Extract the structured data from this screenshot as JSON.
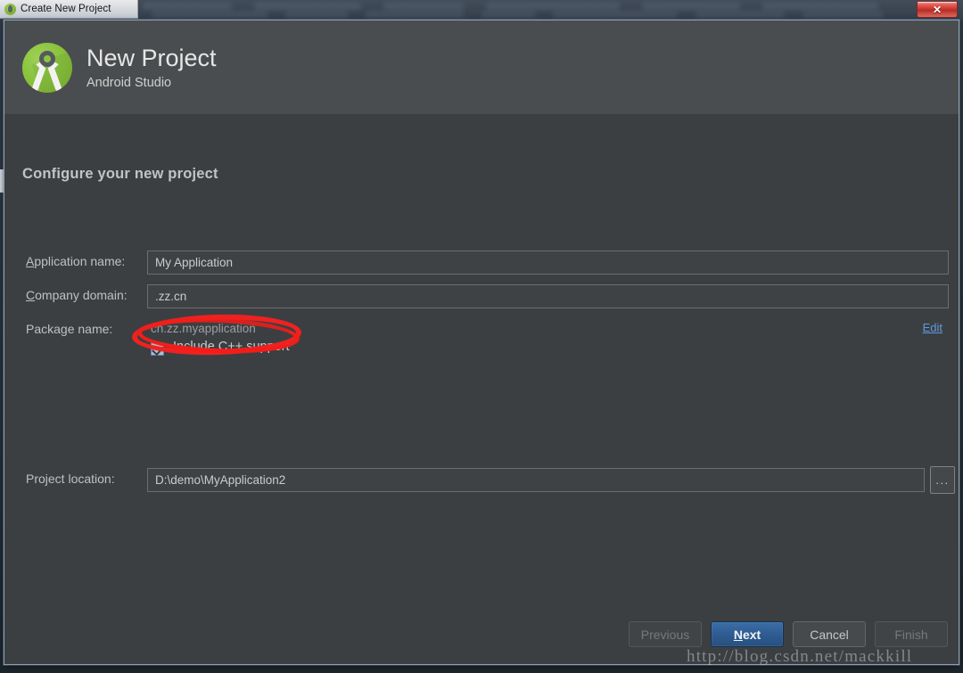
{
  "window": {
    "titlebar_text": "Create New Project",
    "app_icon": "android-studio-icon",
    "close_label": "✕"
  },
  "header": {
    "title": "New Project",
    "subtitle": "Android Studio",
    "logo_icon": "android-studio-logo"
  },
  "step": {
    "title": "Configure your new project"
  },
  "form": {
    "application_name": {
      "label_prefix": "",
      "label_mnemonic": "A",
      "label_rest": "pplication name:",
      "value": "My Application"
    },
    "company_domain": {
      "label_mnemonic": "C",
      "label_rest": "ompany domain:",
      "value": ".zz.cn"
    },
    "package_name": {
      "label": "Package name:",
      "value": "cn.zz.myapplication",
      "edit_link": "Edit"
    },
    "include_cpp": {
      "label": "Include C++ support",
      "checked": true
    },
    "project_location": {
      "label": "Project location:",
      "value": "D:\\demo\\MyApplication2",
      "browse_label": "..."
    }
  },
  "footer": {
    "buttons": [
      {
        "label": "Previous",
        "state": "disabled"
      },
      {
        "label": "Next",
        "mnemonic": "N",
        "rest": "ext",
        "state": "default"
      },
      {
        "label": "Cancel",
        "state": "enabled"
      },
      {
        "label": "Finish",
        "state": "disabled"
      }
    ]
  },
  "watermark": {
    "text": "http://blog.csdn.net/mackkill"
  },
  "colors": {
    "dialog_bg": "#3c3f41",
    "header_bg": "#4a4d4f",
    "accent_blue": "#3b6ea8",
    "link_blue": "#5c9ae0",
    "annotation_red": "#ee2222",
    "logo_green": "#8bc540"
  }
}
